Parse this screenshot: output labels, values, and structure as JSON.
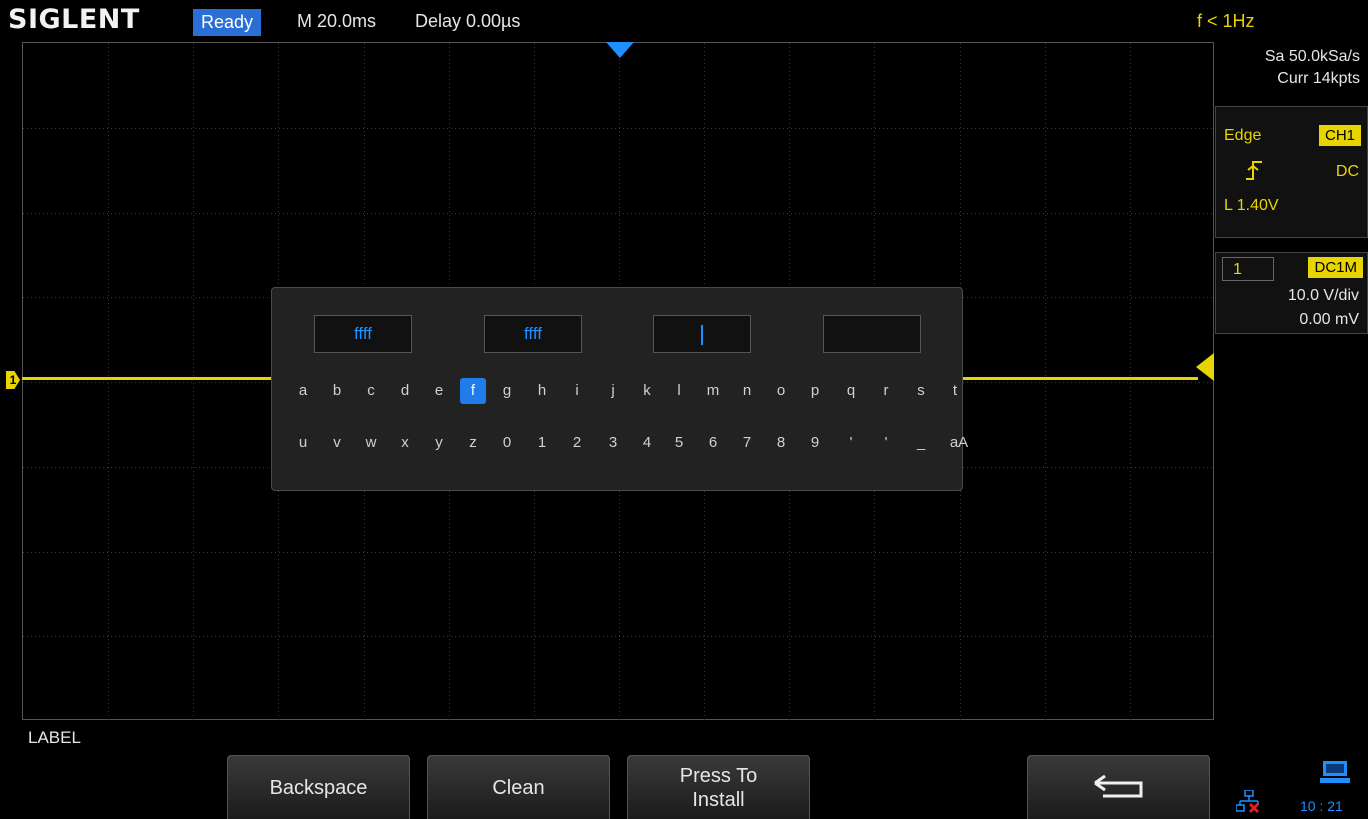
{
  "header": {
    "brand": "SIGLENT",
    "status": "Ready",
    "timebase": "M 20.0ms",
    "delay": "Delay 0.00µs",
    "frequency": "f < 1Hz"
  },
  "acquisition": {
    "sample_rate": "Sa 50.0kSa/s",
    "memory": "Curr 14kpts"
  },
  "trigger": {
    "type": "Edge",
    "source": "CH1",
    "slope_icon": "rising-edge-icon",
    "slope_glyph": "⨍",
    "coupling": "DC",
    "level": "L  1.40V"
  },
  "channel": {
    "number": "1",
    "coupling": "DC1M",
    "volts_per_div": "10.0 V/div",
    "offset": "0.00 mV",
    "marker": "1"
  },
  "keyboard": {
    "label_boxes": [
      "ffff",
      "ffff",
      "",
      ""
    ],
    "active_box_index": 2,
    "row1": [
      "a",
      "b",
      "c",
      "d",
      "e",
      "f",
      "g",
      "h",
      "i",
      "j",
      "k",
      "l",
      "m",
      "n",
      "o",
      "p",
      "q",
      "r",
      "s",
      "t"
    ],
    "row2": [
      "u",
      "v",
      "w",
      "x",
      "y",
      "z",
      "0",
      "1",
      "2",
      "3",
      "4",
      "5",
      "6",
      "7",
      "8",
      "9",
      "'",
      "'",
      "_",
      "aA"
    ],
    "selected_key": "f"
  },
  "menu": {
    "title": "LABEL",
    "softkeys": {
      "backspace": "Backspace",
      "clean": "Clean",
      "install_line1": "Press To",
      "install_line2": "Install",
      "return_icon": "return-arrow-icon"
    }
  },
  "status_bar": {
    "network_icon": "network-disconnected-icon",
    "pc_icon": "pc-connection-icon",
    "time": "10 : 21"
  },
  "colors": {
    "channel1": "#e8d400",
    "accent_blue": "#1e8fff",
    "status_bg": "#2a6fd6"
  }
}
